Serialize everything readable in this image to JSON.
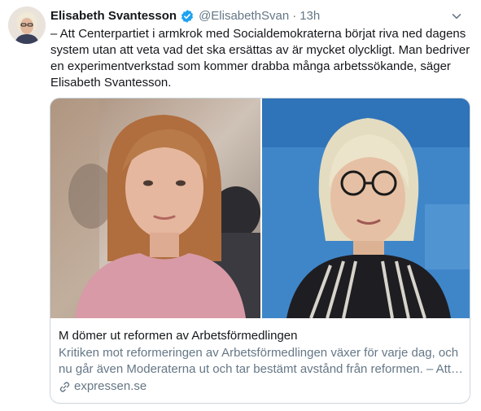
{
  "author": {
    "name": "Elisabeth Svantesson",
    "handle": "@ElisabethSvan",
    "separator": "·",
    "time": "13h"
  },
  "tweet": {
    "text": "– Att Centerpartiet i armkrok med Socialdemokraterna börjat riva ned dagens system utan att veta vad det ska ersättas av är mycket olyckligt. Man bedriver en experimentverkstad som kommer drabba många arbetssökande, säger Elisabeth Svantesson."
  },
  "card": {
    "title": "M dömer ut reformen av Arbetsförmedlingen",
    "description": "Kritiken mot reformeringen av Arbetsförmedlingen växer för varje dag, och nu går även Moderaterna ut och tar bestämt avstånd från reformen. – Att…",
    "domain": "expressen.se"
  },
  "icons": {
    "verified": "verified-badge-icon",
    "caret": "chevron-down-icon",
    "link": "link-icon"
  },
  "colors": {
    "text_primary": "#14171a",
    "text_secondary": "#657786",
    "verified_blue": "#1da1f2",
    "card_border": "#ccd6dd"
  }
}
